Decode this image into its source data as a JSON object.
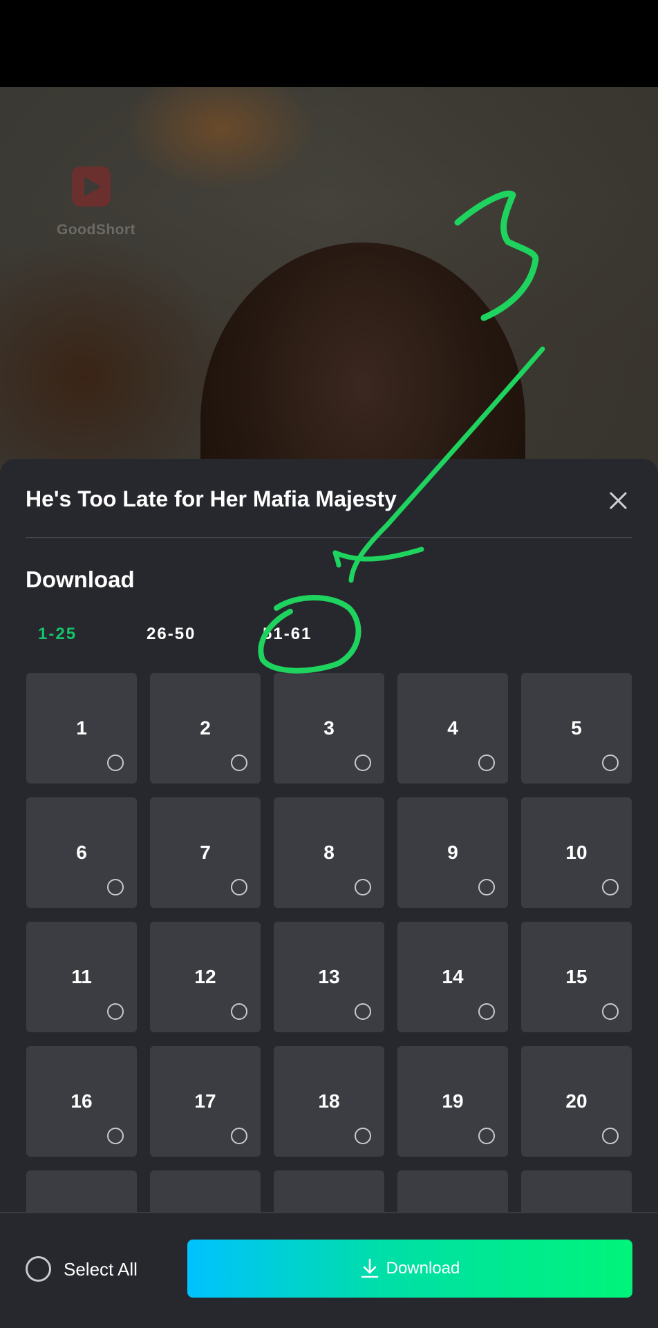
{
  "video": {
    "logo_text": "GoodShort"
  },
  "sheet": {
    "title": "He's Too Late for Her Mafia Majesty",
    "section_heading": "Download",
    "tabs": [
      {
        "label": "1-25",
        "active": true
      },
      {
        "label": "26-50",
        "active": false
      },
      {
        "label": "51-61",
        "active": false
      }
    ],
    "episodes": [
      "1",
      "2",
      "3",
      "4",
      "5",
      "6",
      "7",
      "8",
      "9",
      "10",
      "11",
      "12",
      "13",
      "14",
      "15",
      "16",
      "17",
      "18",
      "19",
      "20",
      "",
      "",
      "",
      "",
      ""
    ]
  },
  "bottom_bar": {
    "select_all_label": "Select All",
    "download_label": "Download"
  },
  "colors": {
    "accent_green": "#14c46a",
    "annotation_green": "#1ed35e",
    "sheet_bg": "#27282e",
    "cell_bg": "#3c3d43"
  },
  "icons": [
    "close-icon",
    "radio-unchecked-icon",
    "download-icon",
    "goodshort-logo"
  ]
}
